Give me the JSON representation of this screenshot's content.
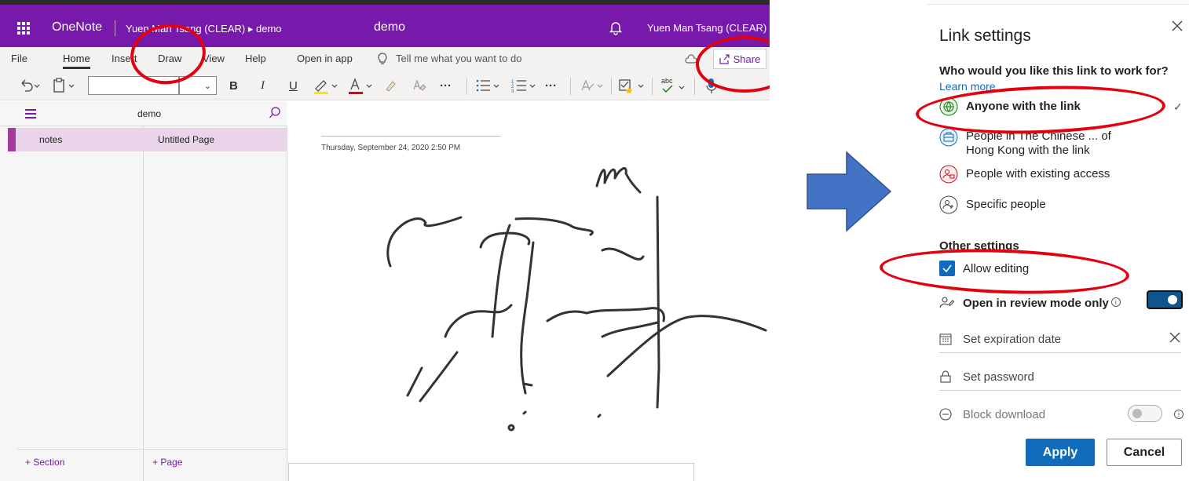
{
  "onenote": {
    "app_name": "OneNote",
    "breadcrumb": "Yuen Man Tsang (CLEAR) ▸ demo",
    "doc_title": "demo",
    "user_name": "Yuen Man Tsang (CLEAR)",
    "accent_color": "#7719aa",
    "menu": {
      "file": "File",
      "home": "Home",
      "insert": "Insert",
      "draw": "Draw",
      "view": "View",
      "help": "Help",
      "open_in_app": "Open in app",
      "tell_me": "Tell me what you want to do",
      "share": "Share"
    },
    "toolbar": {
      "bold": "B",
      "italic": "I",
      "underline": "U",
      "more": "···",
      "spelling": "abc"
    },
    "notebook_name": "demo",
    "sections": [
      {
        "label": "notes"
      }
    ],
    "pages": [
      {
        "label": "Untitled Page"
      }
    ],
    "add_section": "+ Section",
    "add_page": "+ Page",
    "page_date": "Thursday, September 24, 2020    2:50 PM"
  },
  "link_settings": {
    "title": "Link settings",
    "question": "Who would you like this link to work for?",
    "learn_more": "Learn more",
    "options": [
      {
        "label": "Anyone with the link",
        "icon": "globe-icon",
        "color": "#107c10"
      },
      {
        "label": "People in The Chinese ... of",
        "label2": "Hong Kong with the link",
        "icon": "building-icon",
        "color": "#0f6cbd"
      },
      {
        "label": "People with existing access",
        "icon": "lock-people-icon",
        "color": "#c50f1f"
      },
      {
        "label": "Specific people",
        "icon": "people-icon",
        "color": "#444444"
      }
    ],
    "other_settings": "Other settings",
    "allow_editing": "Allow editing",
    "review_mode": "Open in review mode only",
    "expiration": "Set expiration date",
    "password": "Set password",
    "block_download": "Block download",
    "apply": "Apply",
    "cancel": "Cancel",
    "primary_color": "#0f6cbd"
  },
  "annotation_color": "#e3000f",
  "arrow_color": "#4472c4"
}
